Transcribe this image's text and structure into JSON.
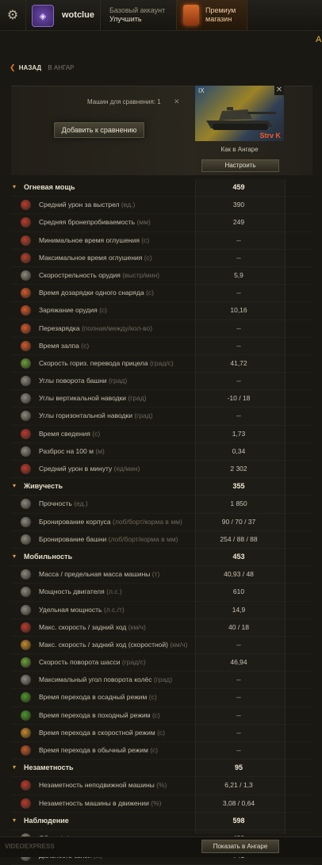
{
  "header": {
    "username": "wotclue",
    "account_type": "Базовый аккаунт",
    "upgrade": "Улучшить",
    "premium_line1": "Премиум",
    "premium_line2": "магазин",
    "edge_letter": "А"
  },
  "nav": {
    "back": "НАЗАД",
    "breadcrumb": "В АНГАР"
  },
  "compare": {
    "count_label": "Машин для сравнения: 1",
    "add_button": "Добавить к сравнению"
  },
  "vehicle": {
    "tier": "IX",
    "name": "Strv K",
    "status": "Как в Ангаре",
    "setup_button": "Настроить"
  },
  "rows": [
    {
      "type": "section",
      "name": "Огневая мощь",
      "value": "459"
    },
    {
      "name": "Средний урон за выстрел",
      "unit": "(ед.)",
      "value": "390",
      "icon": "damage-icon",
      "color": "#c0392b"
    },
    {
      "name": "Средняя бронепробиваемость",
      "unit": "(мм)",
      "value": "249",
      "icon": "penetration-icon",
      "color": "#c0392b"
    },
    {
      "name": "Минимальное время оглушения",
      "unit": "(с)",
      "value": "--",
      "icon": "stun-min-icon",
      "color": "#b8402a"
    },
    {
      "name": "Максимальное время оглушения",
      "unit": "(с)",
      "value": "--",
      "icon": "stun-max-icon",
      "color": "#b8402a"
    },
    {
      "name": "Скорострельность орудия",
      "unit": "(выстр/мин)",
      "value": "5,9",
      "icon": "rate-of-fire-icon",
      "color": "#8d8a80"
    },
    {
      "name": "Время дозарядки одного снаряда",
      "unit": "(с)",
      "value": "--",
      "icon": "shell-reload-icon",
      "color": "#d8582a"
    },
    {
      "name": "Заряжание орудия",
      "unit": "(с)",
      "value": "10,16",
      "icon": "reload-icon",
      "color": "#d8582a"
    },
    {
      "name": "Перезарядка",
      "unit": "(полная/между/кол-во)",
      "value": "--",
      "icon": "autoloader-icon",
      "color": "#d8582a"
    },
    {
      "name": "Время залпа",
      "unit": "(с)",
      "value": "--",
      "icon": "salvo-time-icon",
      "color": "#d8582a"
    },
    {
      "name": "Скорость гориз. перевода прицела",
      "unit": "(град/с)",
      "value": "41,72",
      "icon": "traverse-icon",
      "color": "#6aa23a"
    },
    {
      "name": "Углы поворота башни",
      "unit": "(град)",
      "value": "--",
      "icon": "turret-angle-icon",
      "color": "#8d8a80"
    },
    {
      "name": "Углы вертикальной наводки",
      "unit": "(град)",
      "value": "-10 / 18",
      "icon": "elevation-icon",
      "color": "#8d8a80"
    },
    {
      "name": "Углы горизонтальной наводки",
      "unit": "(град)",
      "value": "--",
      "icon": "horizontal-angle-icon",
      "color": "#8d8a80"
    },
    {
      "name": "Время сведения",
      "unit": "(с)",
      "value": "1,73",
      "icon": "aim-time-icon",
      "color": "#c0392b"
    },
    {
      "name": "Разброс на 100 м",
      "unit": "(м)",
      "value": "0,34",
      "icon": "dispersion-icon",
      "color": "#8d8a80"
    },
    {
      "name": "Средний урон в минуту",
      "unit": "(ед/мин)",
      "value": "2 302",
      "icon": "dpm-icon",
      "color": "#c0392b"
    },
    {
      "type": "section",
      "name": "Живучесть",
      "value": "355"
    },
    {
      "name": "Прочность",
      "unit": "(ед.)",
      "value": "1 850",
      "icon": "hp-icon",
      "color": "#8d8a80"
    },
    {
      "name": "Бронирование корпуса",
      "unit": "(лоб/борт/корма в мм)",
      "value": "90 / 70 / 37",
      "icon": "hull-armor-icon",
      "color": "#8d8a80"
    },
    {
      "name": "Бронирование башни",
      "unit": "(лоб/борт/корма в мм)",
      "value": "254 / 88 / 88",
      "icon": "turret-armor-icon",
      "color": "#8d8a80"
    },
    {
      "type": "section",
      "name": "Мобильность",
      "value": "453"
    },
    {
      "name": "Масса / предельная масса машины",
      "unit": "(т)",
      "value": "40,93 / 48",
      "icon": "weight-icon",
      "color": "#8d8a80"
    },
    {
      "name": "Мощность двигателя",
      "unit": "(л.с.)",
      "value": "610",
      "icon": "engine-icon",
      "color": "#8d8a80"
    },
    {
      "name": "Удельная мощность",
      "unit": "(л.с./т)",
      "value": "14,9",
      "icon": "power-ratio-icon",
      "color": "#8d8a80"
    },
    {
      "name": "Макс. скорость / задний ход",
      "unit": "(км/ч)",
      "value": "40 / 18",
      "icon": "speed-icon",
      "color": "#c0392b"
    },
    {
      "name": "Макс. скорость / задний ход (скоростной)",
      "unit": "(км/ч)",
      "value": "--",
      "icon": "speed-mode-icon",
      "color": "#c98a2a"
    },
    {
      "name": "Скорость поворота шасси",
      "unit": "(град/с)",
      "value": "46,94",
      "icon": "hull-traverse-icon",
      "color": "#6aa23a"
    },
    {
      "name": "Максимальный угол поворота колёс",
      "unit": "(град)",
      "value": "--",
      "icon": "wheel-angle-icon",
      "color": "#8d8a80"
    },
    {
      "name": "Время перехода в осадный режим",
      "unit": "(с)",
      "value": "--",
      "icon": "siege-mode-icon",
      "color": "#4a9a2a"
    },
    {
      "name": "Время перехода в походный режим",
      "unit": "(с)",
      "value": "--",
      "icon": "travel-mode-icon",
      "color": "#4a9a2a"
    },
    {
      "name": "Время перехода в скоростной режим",
      "unit": "(с)",
      "value": "--",
      "icon": "speed-switch-icon",
      "color": "#c98a2a"
    },
    {
      "name": "Время перехода в обычный режим",
      "unit": "(с)",
      "value": "--",
      "icon": "normal-mode-icon",
      "color": "#c05a2a"
    },
    {
      "type": "section",
      "name": "Незаметность",
      "value": "95"
    },
    {
      "name": "Незаметность неподвижной машины",
      "unit": "(%)",
      "value": "6,21 / 1,3",
      "icon": "camo-stationary-icon",
      "color": "#c0392b"
    },
    {
      "name": "Незаметность машины в движении",
      "unit": "(%)",
      "value": "3,08 / 0,64",
      "icon": "camo-moving-icon",
      "color": "#c0392b"
    },
    {
      "type": "section",
      "name": "Наблюдение",
      "value": "598"
    },
    {
      "name": "Обзор",
      "unit": "(м)",
      "value": "400",
      "icon": "view-range-icon",
      "color": "#8d8a80"
    },
    {
      "name": "Дальность связи",
      "unit": "(м)",
      "value": "741",
      "icon": "radio-range-icon",
      "color": "#8d8a80"
    }
  ],
  "footer": {
    "watermark": "VIDEOEXPRESS",
    "show_button": "Показать в Ангаре"
  }
}
